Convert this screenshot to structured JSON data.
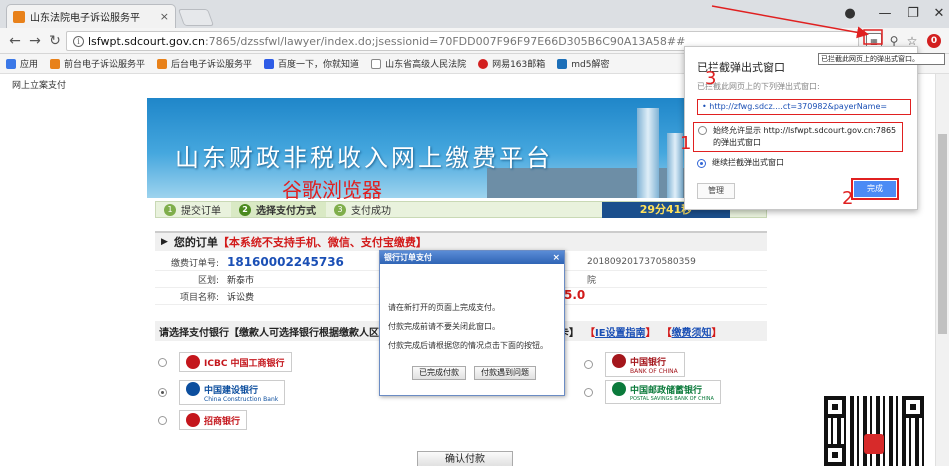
{
  "browser": {
    "tab_title": "山东法院电子诉讼服务平",
    "tab_close": "×",
    "url_host": "lsfwpt.sdcourt.gov.cn",
    "url_path": ":7865/dzssfwl/lawyer/index.do;jsessionid=70FDD007F96F97E66D305B6C90A13A58##",
    "bookmarks": [
      "应用",
      "前台电子诉讼服务平",
      "后台电子诉讼服务平",
      "百度一下，你就知道",
      "山东省高级人民法院",
      "网易163邮箱",
      "md5解密"
    ]
  },
  "page": {
    "header_link": "网上立案支付",
    "annotation_browser": "谷歌浏览器",
    "banner_title": "山东财政非税收入网上缴费平台",
    "steps": [
      {
        "num": "1",
        "label": "提交订单"
      },
      {
        "num": "2",
        "label": "选择支付方式"
      },
      {
        "num": "3",
        "label": "支付成功"
      }
    ],
    "timer": "29分41秒",
    "section_title": "您的订单",
    "section_warning": "【本系统不支持手机、微信、支付宝缴费】",
    "order": {
      "k1": "缴费订单号:",
      "v1": "18160002245736",
      "r1": "2018092017370580359",
      "k2": "区划:",
      "v2": "新泰市",
      "r2": "院",
      "k3": "项目名称:",
      "v3": "诉讼费",
      "amount": "5.0"
    },
    "choose_text": "请选择支付银行【缴款人可选择银行根据缴款人区",
    "choose_suffix": "持信用卡】",
    "link_setup": "IE设置指南",
    "link_notice": "缴费须知",
    "banks": {
      "icbc": "ICBC 中国工商银行",
      "ccb": "中国建设银行",
      "ccb_sub": "China Construction Bank",
      "cmb": "招商银行",
      "boc": "中国银行",
      "boc_sub": "BANK OF CHINA",
      "psbc": "中国邮政储蓄银行",
      "psbc_sub": "POSTAL SAVINGS BANK OF CHINA"
    },
    "confirm_button": "确认付款"
  },
  "modal": {
    "title": "银行订单支付",
    "close": "×",
    "line1": "请在新打开的页面上完成支付。",
    "line2": "付款完成前请不要关闭此窗口。",
    "line3": "付款完成后请根据您的情况点击下面的按钮。",
    "btn_done": "已完成付款",
    "btn_problem": "付款遇到问题"
  },
  "popup_bubble": {
    "title": "已拦截弹出式窗口",
    "desc": "已拦截此网页上的下列弹出式窗口:",
    "blocked_link": "• http://zfwg.sdcz....ct=370982&payerName=",
    "option_allow": "始终允许显示 http://lsfwpt.sdcourt.gov.cn:7865 的弹出式窗口",
    "option_block": "继续拦截弹出式窗口",
    "manage": "管理",
    "done": "完成",
    "tooltip": "已拦截此网页上的弹出式窗口。"
  },
  "annotations": {
    "n1": "1",
    "n2": "2",
    "n3": "3"
  },
  "colors": {
    "annotation_red": "#e02020",
    "primary_blue": "#4c8bf5",
    "warning_red": "#d21a1a"
  }
}
